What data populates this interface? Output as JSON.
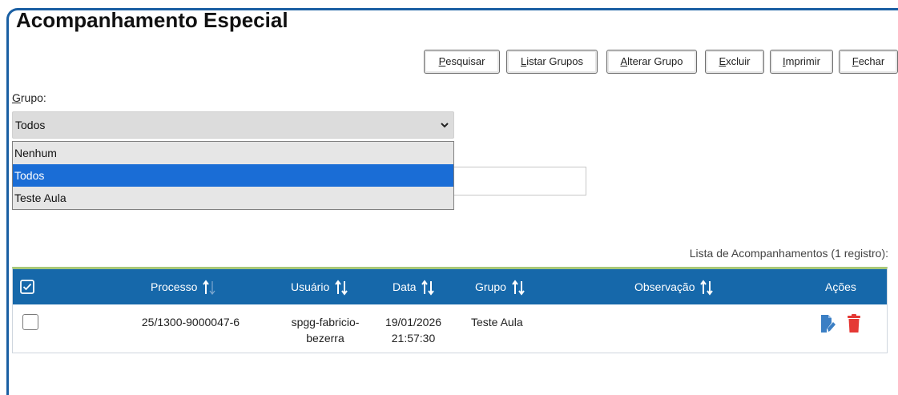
{
  "page": {
    "title": "Acompanhamento Especial"
  },
  "toolbar": {
    "pesquisar": {
      "acc": "P",
      "rest": "esquisar"
    },
    "listar_grupos": {
      "acc": "L",
      "rest": "istar Grupos"
    },
    "alterar_grupo": {
      "acc": "A",
      "rest": "lterar Grupo"
    },
    "excluir": {
      "acc": "E",
      "rest": "xcluir"
    },
    "imprimir": {
      "acc": "I",
      "rest": "mprimir"
    },
    "fechar": {
      "acc": "F",
      "rest": "echar"
    }
  },
  "grupo": {
    "label_acc": "G",
    "label_rest": "rupo:",
    "selected": "Todos",
    "options": [
      "Nenhum",
      "Todos",
      "Teste Aula"
    ]
  },
  "table": {
    "caption": "Lista de Acompanhamentos (1 registro):",
    "headers": {
      "processo": "Processo",
      "usuario": "Usuário",
      "data": "Data",
      "grupo": "Grupo",
      "observacao": "Observação",
      "acoes": "Ações"
    },
    "rows": [
      {
        "processo": "25/1300-9000047-6",
        "usuario_line1": "spgg-fabricio-",
        "usuario_line2": "bezerra",
        "data_line1": "19/01/2026",
        "data_line2": "21:57:30",
        "grupo": "Teste Aula",
        "observacao": ""
      }
    ]
  },
  "colors": {
    "header_bg": "#1668aa",
    "selected_option": "#1a6dd6",
    "edit_icon": "#3b7fc4",
    "delete_icon": "#e53935",
    "frame_border": "#1a5fa3"
  },
  "icons": {
    "select_all": "checkbox-checked-icon",
    "sort": "sort-arrows-icon",
    "edit": "edit-document-icon",
    "delete": "trash-icon",
    "dropdown": "chevron-down-icon"
  }
}
